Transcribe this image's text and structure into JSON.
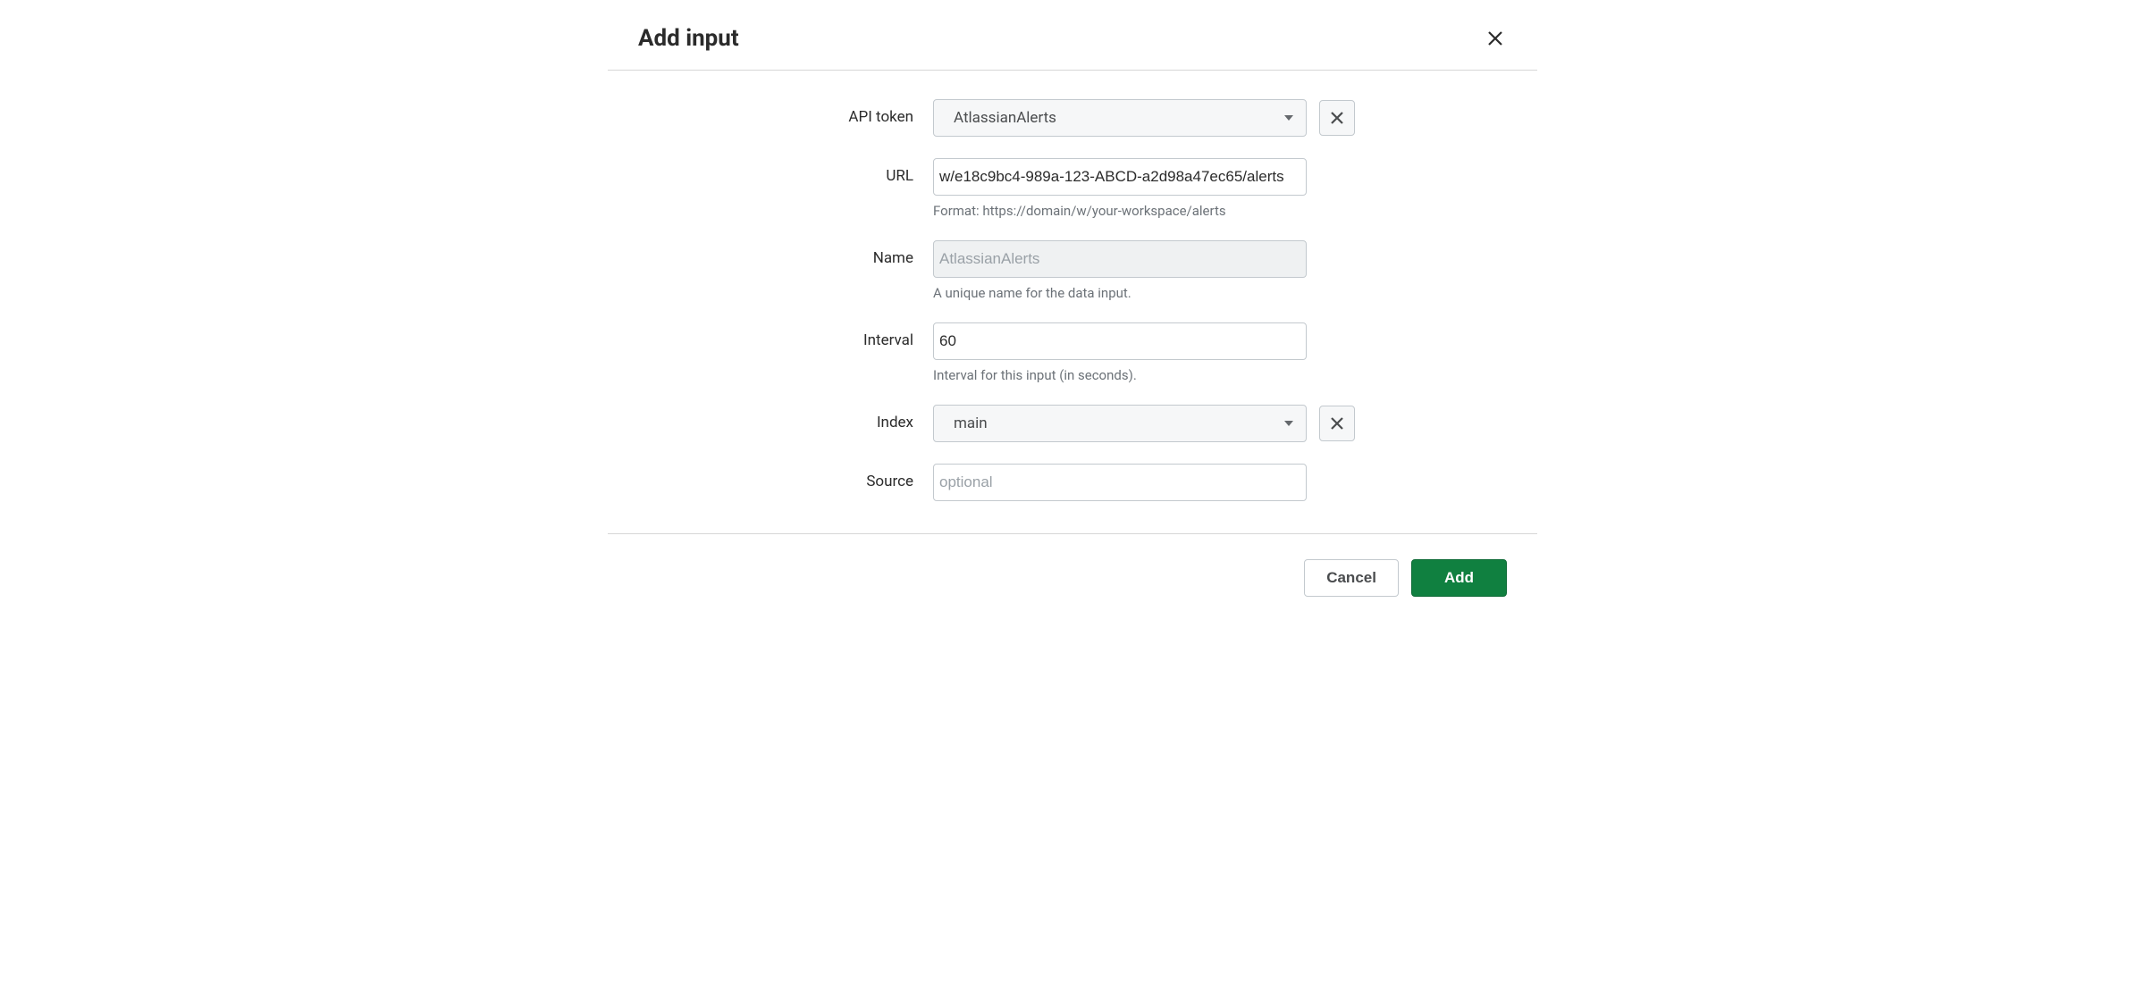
{
  "header": {
    "title": "Add input"
  },
  "fields": {
    "api_token": {
      "label": "API token",
      "selected": "AtlassianAlerts"
    },
    "url": {
      "label": "URL",
      "value": "w/e18c9bc4-989a-123-ABCD-a2d98a47ec65/alerts",
      "help": "Format: https://domain/w/your-workspace/alerts"
    },
    "name": {
      "label": "Name",
      "value": "AtlassianAlerts",
      "help": "A unique name for the data input."
    },
    "interval": {
      "label": "Interval",
      "value": "60",
      "help": "Interval for this input (in seconds)."
    },
    "index": {
      "label": "Index",
      "selected": "main"
    },
    "source": {
      "label": "Source",
      "placeholder": "optional",
      "value": ""
    }
  },
  "footer": {
    "cancel": "Cancel",
    "submit": "Add"
  }
}
